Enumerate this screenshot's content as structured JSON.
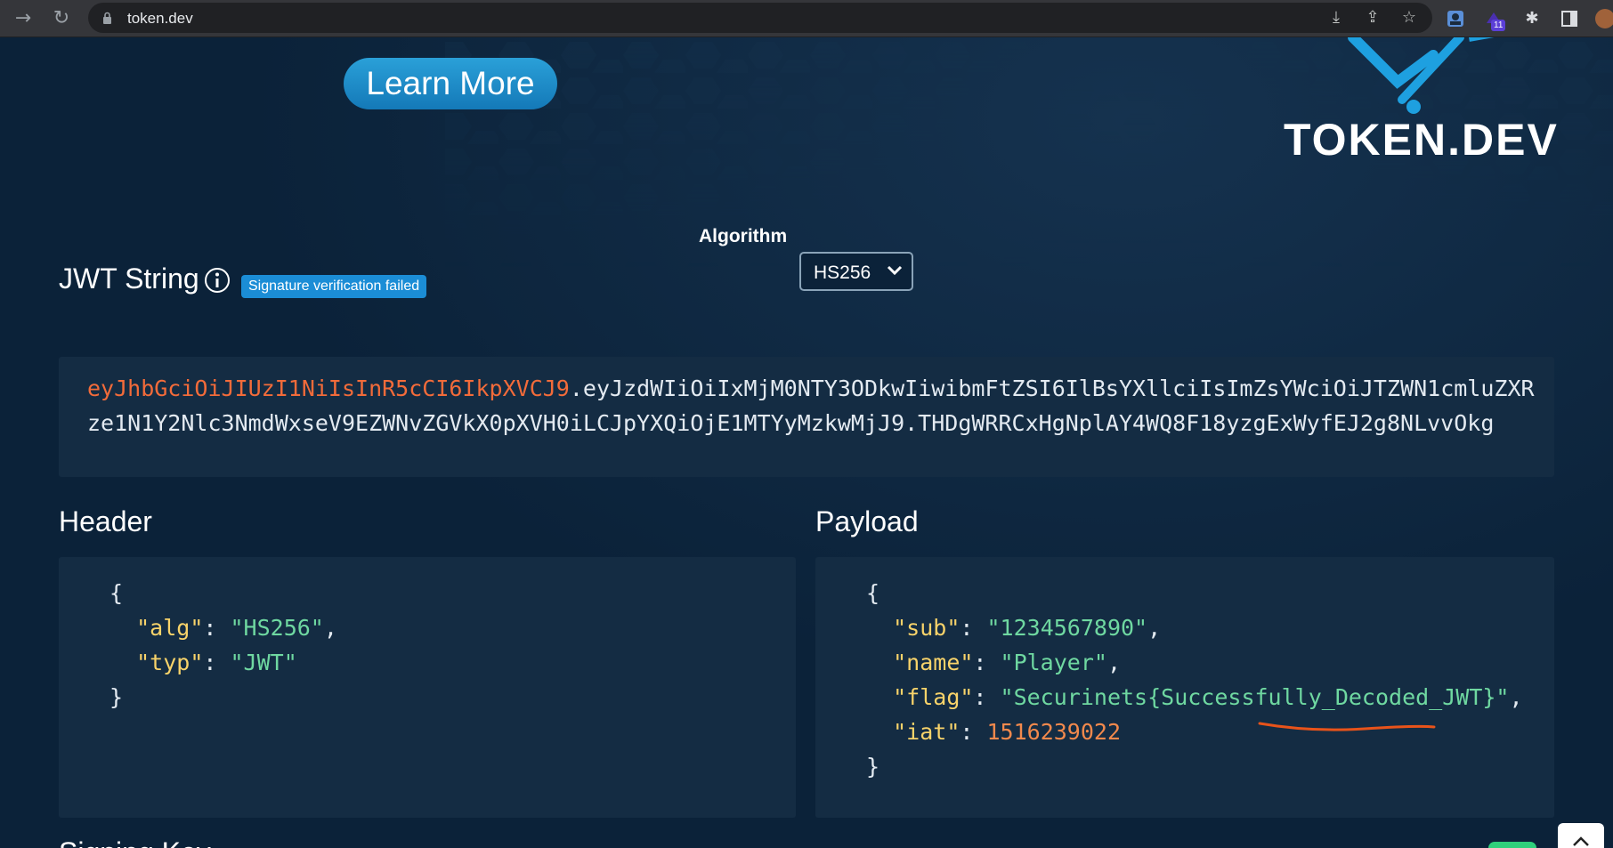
{
  "browser": {
    "url": "token.dev",
    "extension_badge": "11"
  },
  "hero": {
    "learn_more": "Learn More",
    "brand": "TOKEN.DEV"
  },
  "algorithm": {
    "label": "Algorithm",
    "selected": "HS256"
  },
  "jwt": {
    "title": "JWT String",
    "status_badge": "Signature verification failed",
    "header_part": "eyJhbGciOiJIUzI1NiIsInR5cCI6IkpXVCJ9",
    "rest": ".eyJzdWIiOiIxMjM0NTY3ODkwIiwibmFtZSI6IlBsYXllciIsImZsYWciOiJTZWN1cmluZXRze1N1Y2Nlc3NmdWxseV9EZWNvZGVkX0pXVH0iLCJpYXQiOjE1MTYyMzkwMjJ9.THDgWRRCxHgNplAY4WQ8F18yzgExWyfEJ2g8NLvvOkg"
  },
  "header_section": {
    "title": "Header",
    "open": "{",
    "close": "}",
    "entries": [
      {
        "key": "\"alg\"",
        "value": "\"HS256\"",
        "sep": ","
      },
      {
        "key": "\"typ\"",
        "value": "\"JWT\"",
        "sep": ""
      }
    ]
  },
  "payload_section": {
    "title": "Payload",
    "open": "{",
    "close": "}",
    "entries": [
      {
        "key": "\"sub\"",
        "value": "\"1234567890\"",
        "sep": ","
      },
      {
        "key": "\"name\"",
        "value": "\"Player\"",
        "sep": ","
      },
      {
        "key": "\"flag\"",
        "value": "\"Securinets{Successfully_Decoded_JWT}\"",
        "sep": ","
      },
      {
        "key": "\"iat\"",
        "value": "1516239022",
        "sep": ""
      }
    ]
  },
  "signing": {
    "title": "Signing Key"
  },
  "colors": {
    "background": "#0b2239",
    "panel": "#142c43",
    "jwt_header": "#f26b3a",
    "json_key": "#f8d36a",
    "json_string": "#6fd8a1",
    "json_number": "#f2894c",
    "badge": "#1b8dd6"
  }
}
